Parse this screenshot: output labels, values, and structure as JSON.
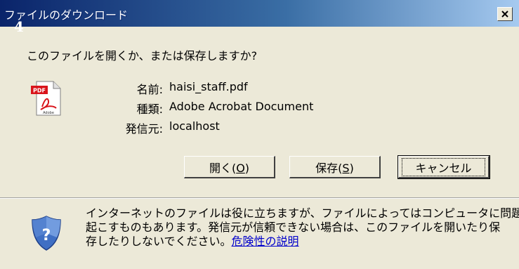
{
  "dialog": {
    "title": "ファイルのダウンロード",
    "corner_mark": "4",
    "prompt": "このファイルを開くか、または保存しますか?",
    "file": {
      "name_label": "名前:",
      "name_value": "haisi_staff.pdf",
      "type_label": "種類:",
      "type_value": "Adobe Acrobat Document",
      "source_label": "発信元:",
      "source_value": "localhost",
      "icon": "pdf-file-icon",
      "icon_badge": "PDF",
      "icon_caption": "Adobe"
    },
    "buttons": {
      "open_label": "開く(",
      "open_key": "O",
      "open_suffix": ")",
      "save_label": "保存(",
      "save_key": "S",
      "save_suffix": ")",
      "cancel_label": "キャンセル"
    },
    "warning": {
      "icon": "security-shield-icon",
      "line1": "インターネットのファイルは役に立ちますが、ファイルによってはコンピュータに問題を",
      "line2": "起こすものもあります。発信元が信頼できない場合は、このファイルを開いたり保",
      "line3": "存したりしないでください。",
      "link": "危険性の説明"
    }
  },
  "colors": {
    "titlebar_start": "#0a246a",
    "titlebar_end": "#a6caf0",
    "dialog_bg": "#ece9d8",
    "link": "#0000cc",
    "pdf_red": "#d9141b"
  }
}
